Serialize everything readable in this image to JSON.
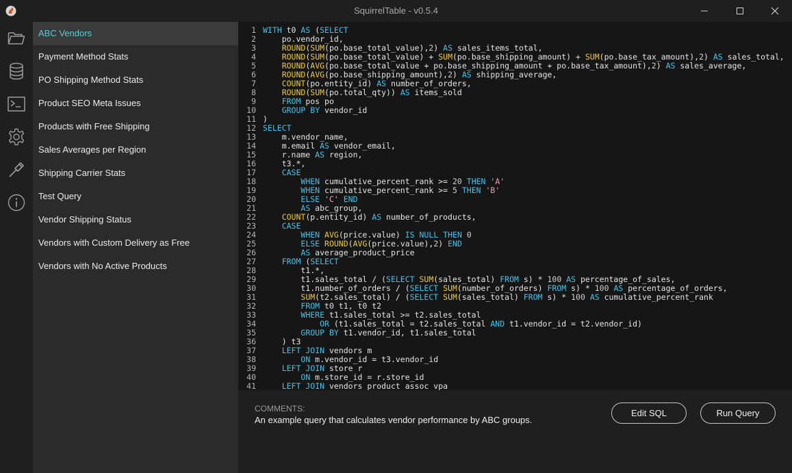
{
  "window": {
    "title": "SquirrelTable - v0.5.4"
  },
  "icons": [
    "folder-icon",
    "database-icon",
    "terminal-icon",
    "gear-icon",
    "hammer-icon",
    "info-icon"
  ],
  "sidebar": {
    "items": [
      {
        "label": "ABC Vendors",
        "active": true
      },
      {
        "label": "Payment Method Stats"
      },
      {
        "label": "PO Shipping Method Stats"
      },
      {
        "label": "Product SEO Meta Issues"
      },
      {
        "label": "Products with Free Shipping"
      },
      {
        "label": "Sales Averages per Region"
      },
      {
        "label": "Shipping Carrier Stats"
      },
      {
        "label": "Test Query"
      },
      {
        "label": "Vendor Shipping Status"
      },
      {
        "label": "Vendors with Custom Delivery as Free"
      },
      {
        "label": "Vendors with No Active Products"
      }
    ]
  },
  "editor": {
    "lines": [
      "WITH t0 AS (SELECT",
      "    po.vendor_id,",
      "    ROUND(SUM(po.base_total_value),2) AS sales_items_total,",
      "    ROUND(SUM(po.base_total_value) + SUM(po.base_shipping_amount) + SUM(po.base_tax_amount),2) AS sales_total,",
      "    ROUND(AVG(po.base_total_value + po.base_shipping_amount + po.base_tax_amount),2) AS sales_average,",
      "    ROUND(AVG(po.base_shipping_amount),2) AS shipping_average,",
      "    COUNT(po.entity_id) AS number_of_orders,",
      "    ROUND(SUM(po.total_qty)) AS items_sold",
      "    FROM pos po",
      "    GROUP BY vendor_id",
      ")",
      "SELECT",
      "    m.vendor_name,",
      "    m.email AS vendor_email,",
      "    r.name AS region,",
      "    t3.*,",
      "    CASE",
      "        WHEN cumulative_percent_rank >= 20 THEN 'A'",
      "        WHEN cumulative_percent_rank >= 5 THEN 'B'",
      "        ELSE 'C' END",
      "        AS abc_group,",
      "    COUNT(p.entity_id) AS number_of_products,",
      "    CASE",
      "        WHEN AVG(price.value) IS NULL THEN 0",
      "        ELSE ROUND(AVG(price.value),2) END",
      "        AS average_product_price",
      "    FROM (SELECT",
      "        t1.*,",
      "        t1.sales_total / (SELECT SUM(sales_total) FROM s) * 100 AS percentage_of_sales,",
      "        t1.number_of_orders / (SELECT SUM(number_of_orders) FROM s) * 100 AS percentage_of_orders,",
      "        SUM(t2.sales_total) / (SELECT SUM(sales_total) FROM s) * 100 AS cumulative_percent_rank",
      "        FROM t0 t1, t0 t2",
      "        WHERE t1.sales_total >= t2.sales_total",
      "            OR (t1.sales_total = t2.sales_total AND t1.vendor_id = t2.vendor_id)",
      "        GROUP BY t1.vendor_id, t1.sales_total",
      "    ) t3",
      "    LEFT JOIN vendors m",
      "        ON m.vendor_id = t3.vendor_id",
      "    LEFT JOIN store r",
      "        ON m.store_id = r.store_id",
      "    LEFT JOIN vendors_product_assoc vpa"
    ]
  },
  "comments": {
    "label": "COMMENTS:",
    "text": "An example query that calculates vendor performance by ABC groups."
  },
  "buttons": {
    "edit_sql": "Edit SQL",
    "run_query": "Run Query"
  },
  "colors": {
    "accent": "#63c7cf",
    "keyword": "#3cc6ef",
    "function": "#f0c93a",
    "string": "#f0a0b4"
  }
}
